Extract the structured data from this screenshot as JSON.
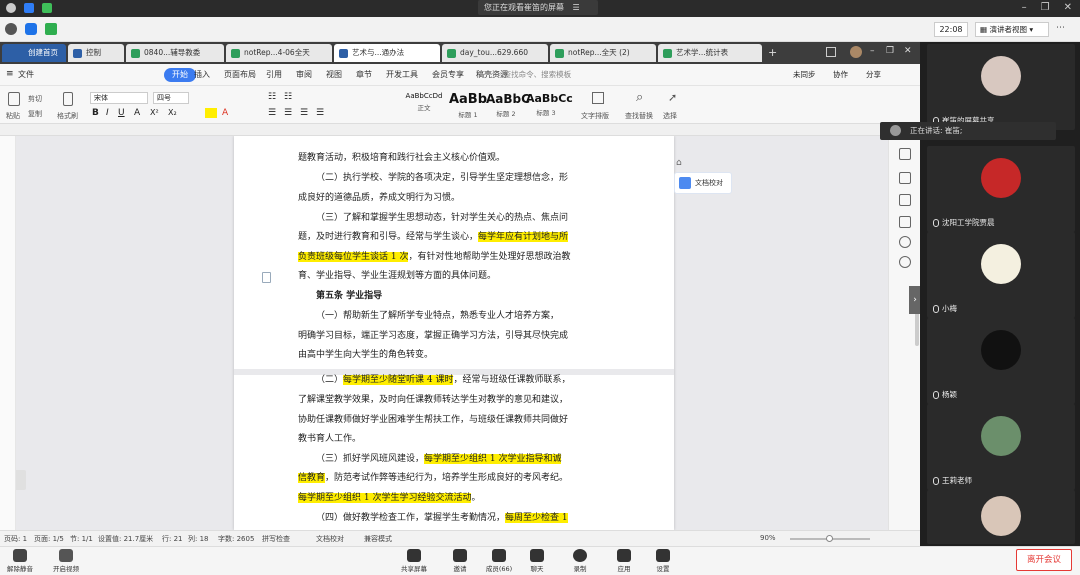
{
  "meeting": {
    "share_notice": "您正在观看崔笛的屏幕",
    "clock": "22:08",
    "view_mode": "演讲者视图",
    "speaking": "正在讲话: 崔笛;",
    "leave_label": "离开会议",
    "bottom_left": [
      {
        "label": "解除静音",
        "icon": "mic-muted-icon"
      },
      {
        "label": "开启视频",
        "icon": "camera-off-icon"
      }
    ],
    "bottom_center": [
      {
        "label": "共享屏幕",
        "icon": "share-screen-icon"
      },
      {
        "label": "邀请",
        "icon": "invite-icon"
      },
      {
        "label": "成员(66)",
        "icon": "members-icon"
      },
      {
        "label": "聊天",
        "icon": "chat-icon"
      },
      {
        "label": "录制",
        "icon": "record-icon"
      },
      {
        "label": "应用",
        "icon": "apps-icon"
      },
      {
        "label": "设置",
        "icon": "settings-icon"
      }
    ],
    "participants": [
      {
        "name": "崔笛的屏幕共享",
        "color": "#d8c8c0"
      },
      {
        "name": "沈阳工学院贾晨",
        "color": "#c62828"
      },
      {
        "name": "小梅",
        "color": "#f4f0e0"
      },
      {
        "name": "杨颖",
        "color": "#111111"
      },
      {
        "name": "王莉老师",
        "color": "#6b8f6b"
      },
      {
        "name": "",
        "color": "#d9c6b8"
      }
    ]
  },
  "wps": {
    "home_tab": "创建首页",
    "tabs": [
      {
        "label": "控制",
        "color": "#2d5fa6"
      },
      {
        "label": "0840...辅导教委",
        "color": "#2e9e5b"
      },
      {
        "label": "notRep...4-06全天",
        "color": "#2e9e5b"
      },
      {
        "label": "艺术与...通办法",
        "color": "#2d5fa6"
      },
      {
        "label": "day_tou...629.660",
        "color": "#2e9e5b"
      },
      {
        "label": "notRep...全天 (2)",
        "color": "#2e9e5b"
      },
      {
        "label": "艺术学...统计表",
        "color": "#2e9e5b"
      }
    ],
    "menu": [
      "文件",
      "开始",
      "插入",
      "页面布局",
      "引用",
      "审阅",
      "视图",
      "章节",
      "开发工具",
      "会员专享",
      "稿壳资源"
    ],
    "menu_active": "开始",
    "search_placeholder": "查找命令、搜索模板",
    "top_right": [
      "未同步",
      "协作",
      "分享"
    ],
    "ribbon": {
      "paste": "粘贴",
      "cut": "剪切",
      "copy": "复制",
      "format_painter": "格式刷",
      "font": "宋体",
      "size": "四号",
      "styles": [
        {
          "sample": "AaBbCcDd",
          "name": "正文"
        },
        {
          "sample": "AaBb",
          "name": "标题 1"
        },
        {
          "sample": "AaBbC",
          "name": "标题 2"
        },
        {
          "sample": "AaBbCc",
          "name": "标题 3"
        }
      ],
      "text_layout": "文字排版",
      "find_replace": "查找替换",
      "select": "选择"
    },
    "proof_button": "文档校对",
    "document": [
      {
        "runs": [
          {
            "t": "题教育活动，积极培育和践行社会主义核心价值观。"
          }
        ]
      },
      {
        "runs": [
          {
            "t": "（二）执行学校、学院的各项决定，引导学生坚定理想信念，形"
          }
        ]
      },
      {
        "runs": [
          {
            "t": "成良好的道德品质，养成文明行为习惯。"
          }
        ]
      },
      {
        "runs": [
          {
            "t": "（三）了解和掌握学生思想动态，针对学生关心的热点、焦点问"
          }
        ]
      },
      {
        "runs": [
          {
            "t": "题，及时进行教育和引导。经常与学生谈心，"
          },
          {
            "t": "每学年应有计划地与所",
            "h": true
          }
        ]
      },
      {
        "runs": [
          {
            "t": "负责班级每位学生谈话 1 次",
            "h": true
          },
          {
            "t": "，有针对性地帮助学生处理好思想政治教"
          }
        ]
      },
      {
        "runs": [
          {
            "t": "育、学业指导、学业生涯规划等方面的具体问题。"
          }
        ]
      },
      {
        "runs": [
          {
            "t": "第五条  学业指导",
            "b": true
          }
        ]
      },
      {
        "runs": [
          {
            "t": "（一）帮助新生了解所学专业特点，熟悉专业人才培养方案，"
          }
        ]
      },
      {
        "runs": [
          {
            "t": "明确学习目标，端正学习态度，掌握正确学习方法，引导其尽快完成"
          }
        ]
      },
      {
        "runs": [
          {
            "t": "由高中学生向大学生的角色转变。"
          }
        ]
      },
      {
        "runs": [
          {
            "t": "（二）"
          },
          {
            "t": "每学期至少随堂听课 4 课时",
            "h": true
          },
          {
            "t": "，经常与班级任课教师联系，"
          }
        ]
      },
      {
        "runs": [
          {
            "t": "了解课堂教学效果，及时向任课教师转达学生对教学的意见和建议，"
          }
        ]
      },
      {
        "runs": [
          {
            "t": "协助任课教师做好学业困难学生帮扶工作，与班级任课教师共同做好"
          }
        ]
      },
      {
        "runs": [
          {
            "t": "教书育人工作。"
          }
        ]
      },
      {
        "runs": [
          {
            "t": "（三）抓好学风班风建设，"
          },
          {
            "t": "每学期至少组织 1 次学业指导和诚",
            "h": true
          }
        ]
      },
      {
        "runs": [
          {
            "t": "信教育",
            "h": true
          },
          {
            "t": "，防范考试作弊等违纪行为，培养学生形成良好的考风考纪。"
          }
        ]
      },
      {
        "runs": [
          {
            "t": "每学期至少组织 1 次学生学习经验交流活动",
            "h": true
          },
          {
            "t": "。"
          }
        ]
      },
      {
        "runs": [
          {
            "t": "（四）做好教学检查工作，掌握学生考勤情况，"
          },
          {
            "t": "每周至少检查 1",
            "h": true
          }
        ]
      }
    ],
    "status": {
      "page": "页码: 1",
      "pages": "页面: 1/5",
      "section": "节: 1/1",
      "setting": "设置值: 21.7厘米",
      "row": "行: 21",
      "col": "列: 18",
      "words": "字数: 2605",
      "spell": "拼写检查",
      "proof": "文档校对",
      "compat": "兼容模式",
      "zoom": "90%"
    }
  }
}
